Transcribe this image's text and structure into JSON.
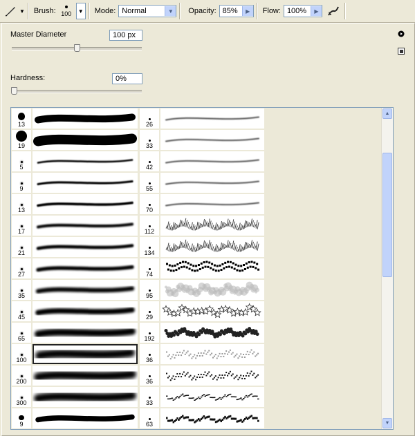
{
  "toolbar": {
    "brush_label": "Brush:",
    "brush_size": "100",
    "mode_label": "Mode:",
    "mode_value": "Normal",
    "opacity_label": "Opacity:",
    "opacity_value": "85%",
    "flow_label": "Flow:",
    "flow_value": "100%"
  },
  "panel": {
    "master_diameter_label": "Master Diameter",
    "master_diameter_value": "100 px",
    "master_diameter_level": 0.5,
    "hardness_label": "Hardness:",
    "hardness_value": "0%",
    "hardness_level": 0.0
  },
  "brushes": {
    "left": [
      {
        "size": "13",
        "type": "hard"
      },
      {
        "size": "19",
        "type": "hard"
      },
      {
        "size": "5",
        "type": "soft"
      },
      {
        "size": "9",
        "type": "soft"
      },
      {
        "size": "13",
        "type": "soft"
      },
      {
        "size": "17",
        "type": "soft"
      },
      {
        "size": "21",
        "type": "soft"
      },
      {
        "size": "27",
        "type": "soft"
      },
      {
        "size": "35",
        "type": "soft"
      },
      {
        "size": "45",
        "type": "soft"
      },
      {
        "size": "65",
        "type": "soft"
      },
      {
        "size": "100",
        "type": "soft",
        "selected": true
      },
      {
        "size": "200",
        "type": "soft"
      },
      {
        "size": "300",
        "type": "soft"
      },
      {
        "size": "9",
        "type": "hard"
      }
    ],
    "right": [
      {
        "size": "26",
        "type": "star"
      },
      {
        "size": "33",
        "type": "star"
      },
      {
        "size": "42",
        "type": "star"
      },
      {
        "size": "55",
        "type": "star"
      },
      {
        "size": "70",
        "type": "star"
      },
      {
        "size": "112",
        "type": "grass"
      },
      {
        "size": "134",
        "type": "grass"
      },
      {
        "size": "74",
        "type": "leaf"
      },
      {
        "size": "95",
        "type": "blob"
      },
      {
        "size": "29",
        "type": "stars"
      },
      {
        "size": "192",
        "type": "spatter"
      },
      {
        "size": "36",
        "type": "chalk"
      },
      {
        "size": "36",
        "type": "chalk"
      },
      {
        "size": "33",
        "type": "charcoal"
      },
      {
        "size": "63",
        "type": "charcoal"
      }
    ]
  }
}
